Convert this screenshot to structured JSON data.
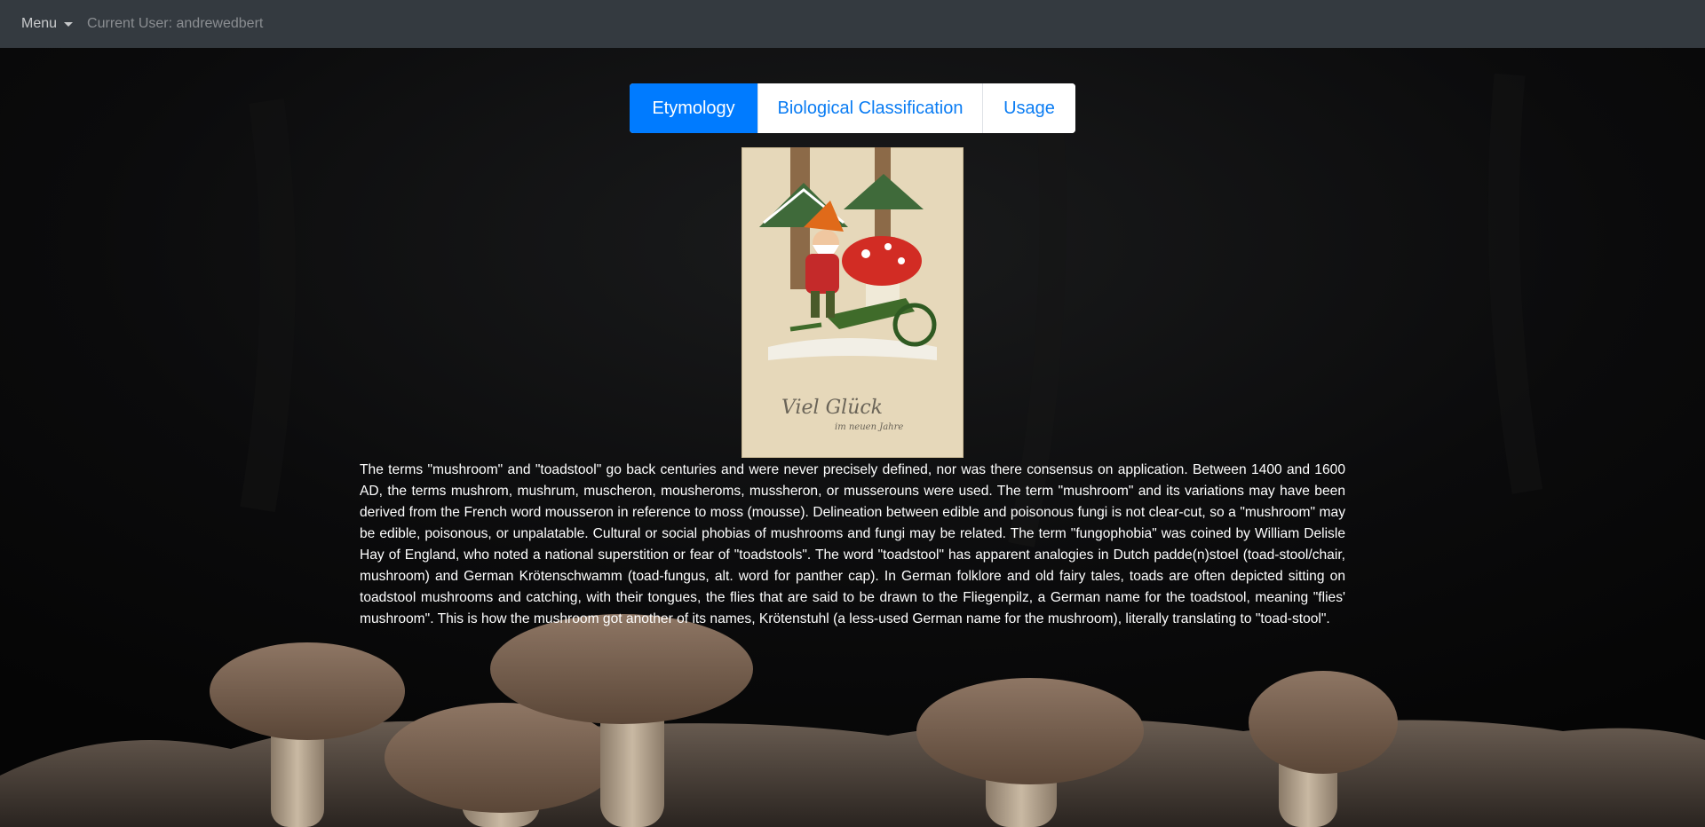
{
  "navbar": {
    "menu_label": "Menu",
    "current_user": "Current User: andrewedbert"
  },
  "tabs": [
    {
      "label": "Etymology",
      "active": true
    },
    {
      "label": "Biological Classification",
      "active": false
    },
    {
      "label": "Usage",
      "active": false
    }
  ],
  "postcard": {
    "caption_line1": "Viel Glück",
    "caption_line2": "im neuen Jahre"
  },
  "article": {
    "text": "The terms \"mushroom\" and \"toadstool\" go back centuries and were never precisely defined, nor was there consensus on application. Between 1400 and 1600 AD, the terms mushrom, mushrum, muscheron, mousheroms, mussheron, or musserouns were used. The term \"mushroom\" and its variations may have been derived from the French word mousseron in reference to moss (mousse). Delineation between edible and poisonous fungi is not clear-cut, so a \"mushroom\" may be edible, poisonous, or unpalatable. Cultural or social phobias of mushrooms and fungi may be related. The term \"fungophobia\" was coined by William Delisle Hay of England, who noted a national superstition or fear of \"toadstools\". The word \"toadstool\" has apparent analogies in Dutch padde(n)stoel (toad-stool/chair, mushroom) and German Krötenschwamm (toad-fungus, alt. word for panther cap). In German folklore and old fairy tales, toads are often depicted sitting on toadstool mushrooms and catching, with their tongues, the flies that are said to be drawn to the Fliegenpilz, a German name for the toadstool, meaning \"flies' mushroom\". This is how the mushroom got another of its names, Krötenstuhl (a less-used German name for the mushroom), literally translating to \"toad-stool\"."
  },
  "colors": {
    "navbar_bg": "#343a40",
    "tab_active_bg": "#007bff",
    "tab_text": "#0a7cf3",
    "page_bg": "#070707"
  }
}
